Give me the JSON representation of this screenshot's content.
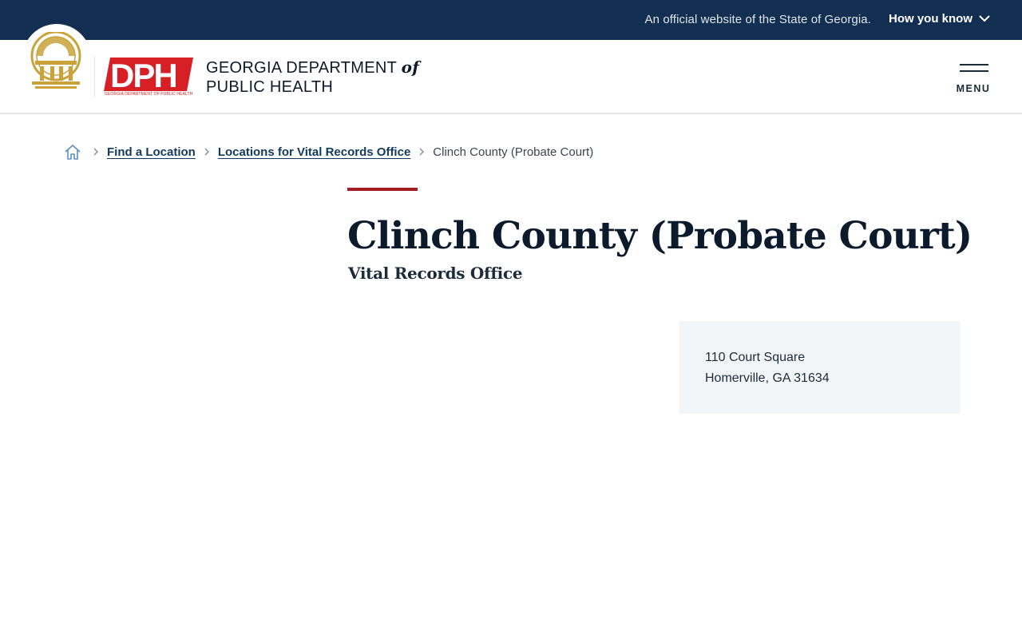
{
  "gov_banner": {
    "official_text": "An official website of the State of Georgia.",
    "how_you_know_label": "How you know"
  },
  "header": {
    "logo_mark": "DPH",
    "logo_tagline": "GEORGIA DEPARTMENT OF PUBLIC HEALTH",
    "agency_line1": "GEORGIA DEPARTMENT",
    "agency_of": "of",
    "agency_line2": "PUBLIC HEALTH",
    "menu_label": "MENU"
  },
  "breadcrumb": {
    "items": [
      {
        "label": "Find a Location"
      },
      {
        "label": "Locations for Vital Records Office"
      },
      {
        "label": "Clinch County (Probate Court)"
      }
    ]
  },
  "main": {
    "title": "Clinch County (Probate Court)",
    "subtitle": "Vital Records Office",
    "address_line1": "110 Court Square",
    "address_line2": "Homerville, GA 31634"
  },
  "colors": {
    "banner_bg": "#122f52",
    "accent_red": "#a51d24",
    "dph_red": "#d71f26",
    "seal_gold": "#c9a33a",
    "card_bg": "#f3f6f9"
  }
}
